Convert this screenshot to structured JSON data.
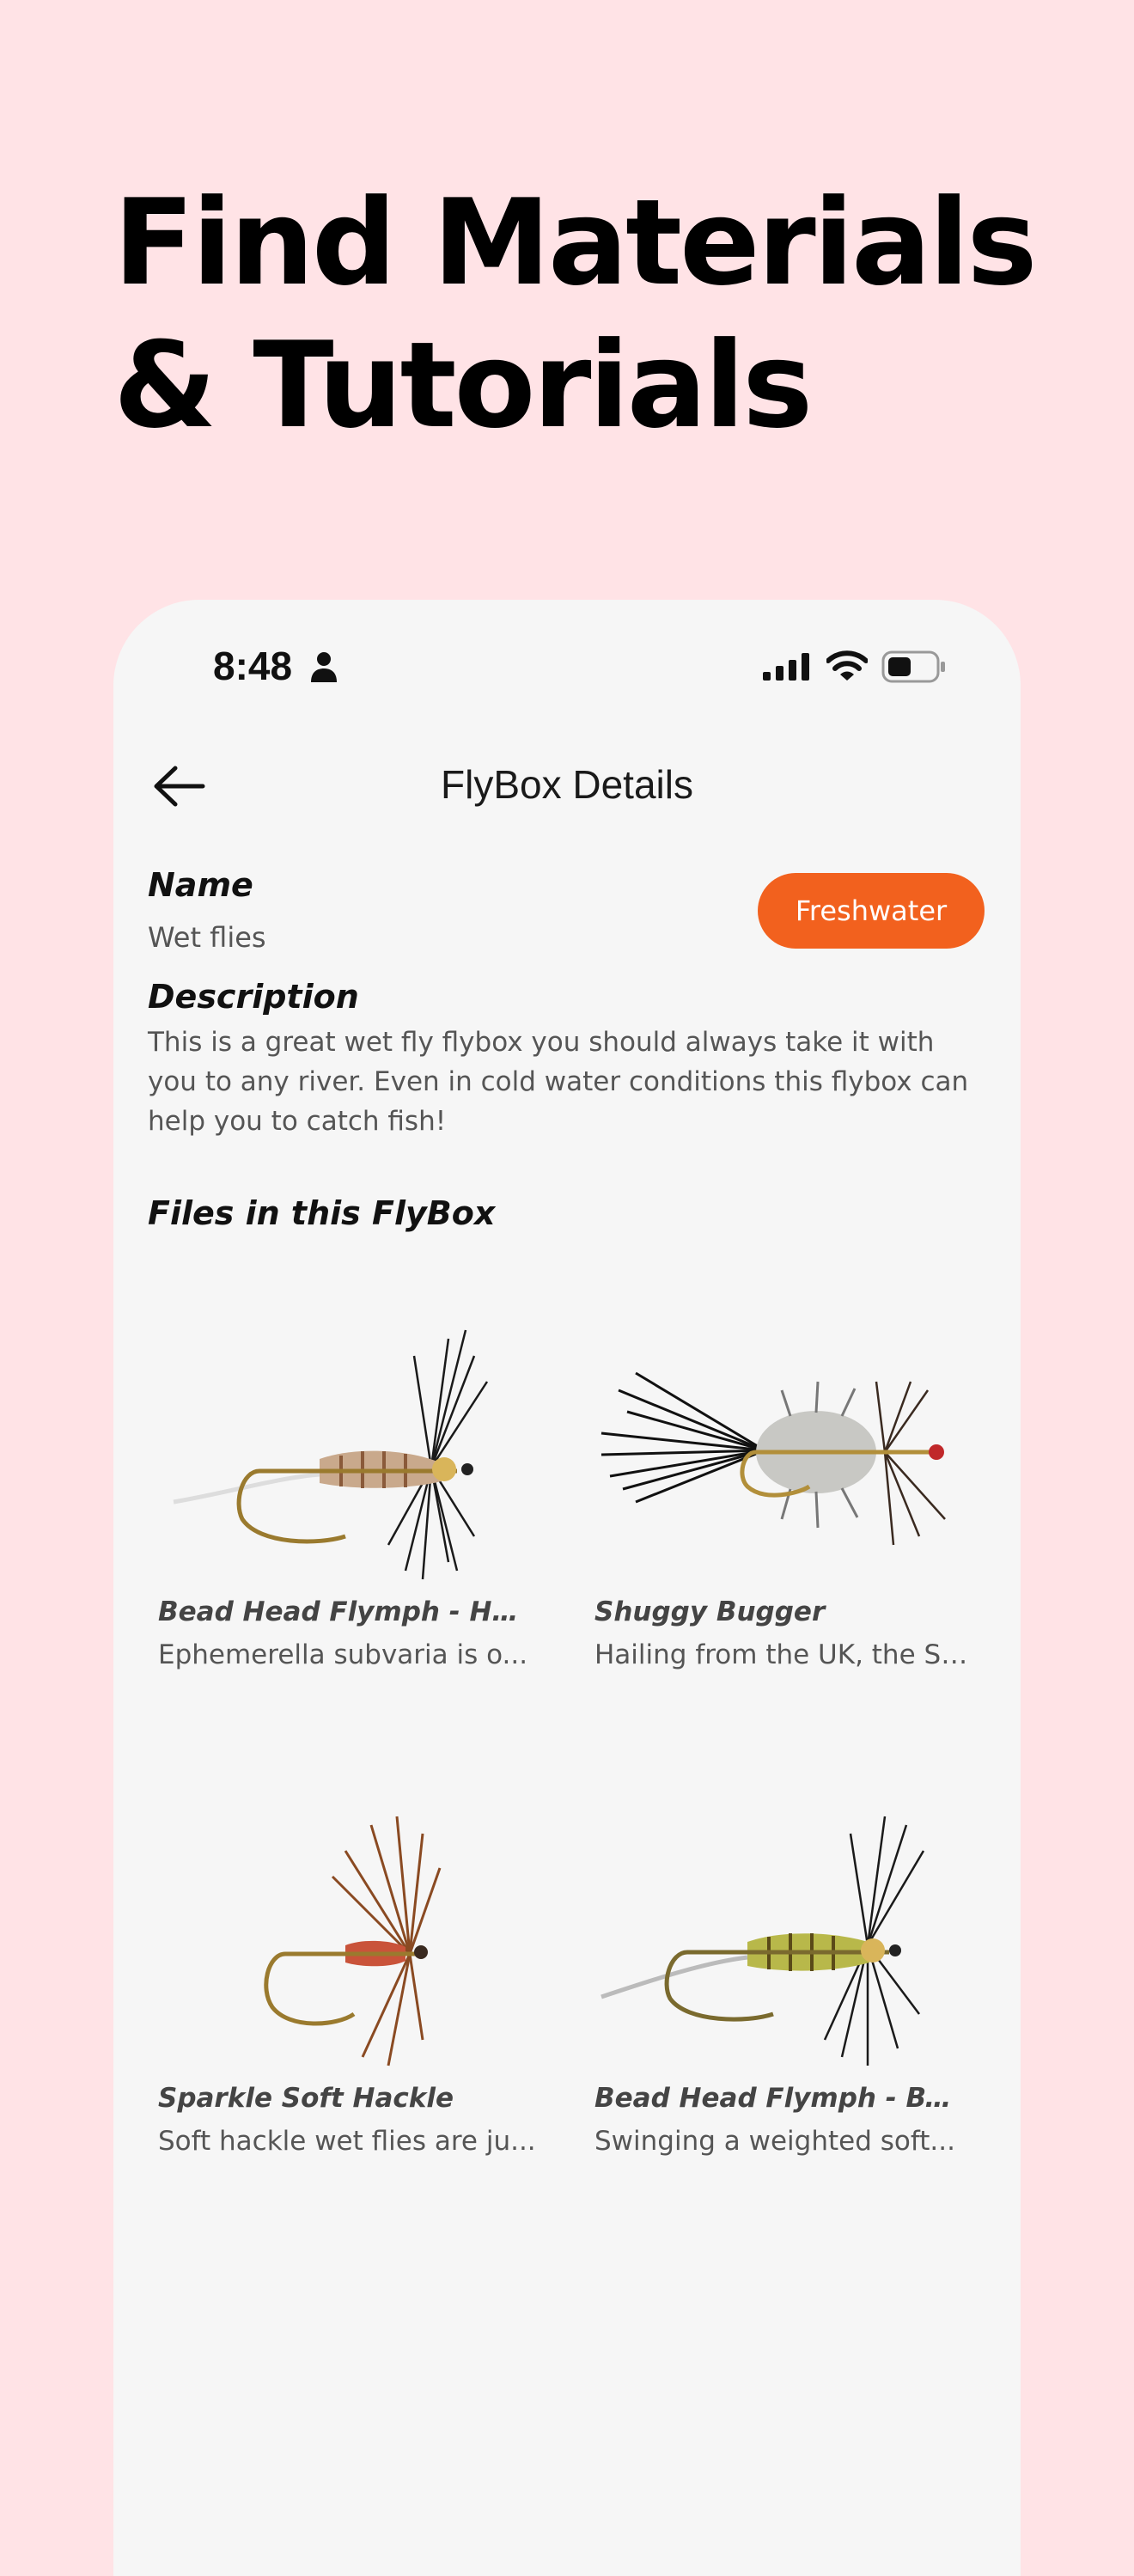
{
  "headline": {
    "line1": "Find Materials",
    "line2": "& Tutorials"
  },
  "status_bar": {
    "time": "8:48"
  },
  "nav": {
    "title": "FlyBox Details"
  },
  "details": {
    "name_label": "Name",
    "name_value": "Wet flies",
    "category_tag": "Freshwater",
    "description_label": "Description",
    "description_text": "This is a great wet fly flybox you should always take it with you to any river. Even in cold water conditions this flybox can help you to catch fish!",
    "files_label": "Files in this FlyBox"
  },
  "files": [
    {
      "title": "Bead Head Flymph - Hen...",
      "subtitle": "Ephemerella subvaria is o..."
    },
    {
      "title": "Shuggy Bugger",
      "subtitle": "Hailing from the UK, the Sh..."
    },
    {
      "title": "Sparkle Soft Hackle",
      "subtitle": "Soft hackle wet flies are ju..."
    },
    {
      "title": "Bead Head Flymph - BWO",
      "subtitle": "Swinging a weighted soft..."
    }
  ],
  "colors": {
    "background": "#FFE3E6",
    "accent": "#F2611E",
    "phone_bg": "#F6F6F6"
  }
}
